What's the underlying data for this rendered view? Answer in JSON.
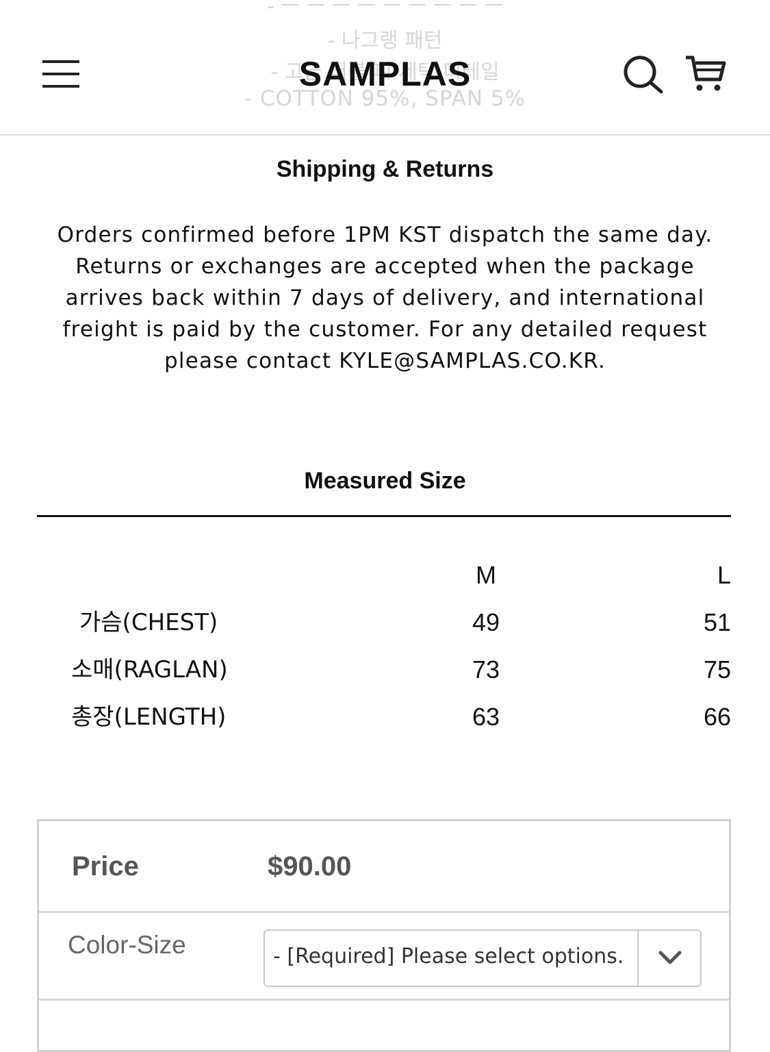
{
  "header": {
    "logo": "SAMPLAS",
    "background_lines": [
      "- ㅡ ㅡ ㅡ ㅡ ㅡ ㅡ ㅡ ㅡ ㅡ",
      "- 나그랭 패턴",
      "- 고급 더블 피 세탁 디테일",
      "- COTTON 95%, SPAN 5%"
    ],
    "icons": [
      "menu-icon",
      "search-icon",
      "cart-icon"
    ]
  },
  "shipping": {
    "title": "Shipping & Returns",
    "text": "Orders confirmed before 1PM KST dispatch the same day. Returns or exchanges are accepted when the package arrives back within 7 days of delivery, and international freight is paid by the customer. For any detailed request please contact KYLE@SAMPLAS.CO.KR."
  },
  "measured": {
    "title": "Measured Size",
    "columns": [
      "M",
      "L"
    ],
    "rows": [
      {
        "label": "가슴(CHEST)",
        "m": "49",
        "l": "51"
      },
      {
        "label": "소매(RAGLAN)",
        "m": "73",
        "l": "75"
      },
      {
        "label": "총장(LENGTH)",
        "m": "63",
        "l": "66"
      }
    ]
  },
  "purchase": {
    "price_label": "Price",
    "price_value": "$90.00",
    "option_label": "Color-Size",
    "select_value": "- [Required] Please select options."
  },
  "colors": {
    "text": "#111111",
    "muted": "#555555",
    "watermark": "#d6d6d6",
    "border": "#d0d0d0"
  }
}
